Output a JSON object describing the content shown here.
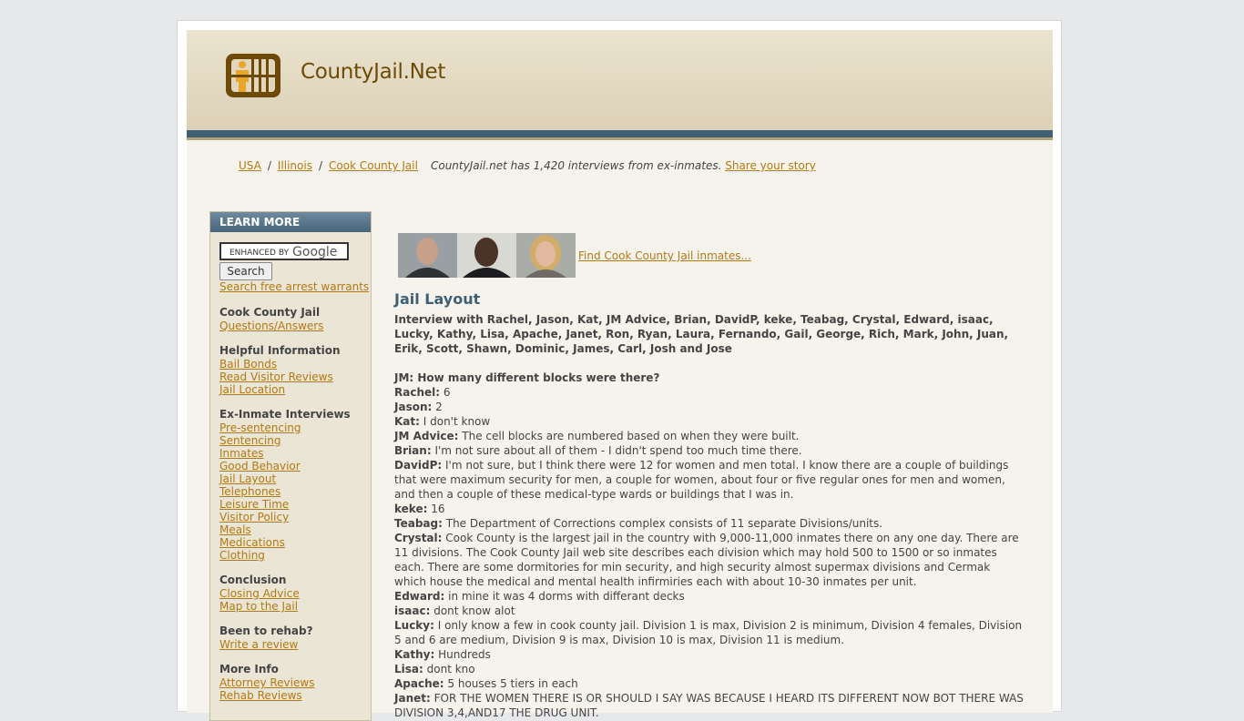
{
  "site": {
    "title": "CountyJail.Net",
    "brand_color": "#6e4a08",
    "band_color": "#3f5f75",
    "link_color": "#b17a14"
  },
  "breadcrumb": {
    "items": [
      "USA",
      "Illinois",
      "Cook County Jail"
    ],
    "note": "CountyJail.net has 1,420 interviews from ex-inmates.",
    "share_link": "Share your story"
  },
  "sidebar": {
    "heading": "LEARN MORE",
    "search_prefix": "ENHANCED BY",
    "search_brand": "Google",
    "search_button": "Search",
    "warrants_link": "Search free arrest warrants",
    "sections": [
      {
        "title": "Cook County Jail",
        "links": [
          "Questions/Answers"
        ]
      },
      {
        "title": "Helpful Information",
        "links": [
          "Bail Bonds",
          "Read Visitor Reviews",
          "Jail Location"
        ]
      },
      {
        "title": "Ex-Inmate Interviews",
        "links": [
          "Pre-sentencing",
          "Sentencing",
          "Inmates",
          "Good Behavior",
          "Jail Layout",
          "Telephones",
          "Leisure Time",
          "Visitor Policy",
          "Meals",
          "Medications",
          "Clothing"
        ]
      },
      {
        "title": "Conclusion",
        "links": [
          "Closing Advice",
          "Map to the Jail"
        ]
      },
      {
        "title": "Been to rehab?",
        "links": [
          "Write a review"
        ]
      },
      {
        "title": "More Info",
        "links": [
          "Attorney Reviews",
          "Rehab Reviews"
        ]
      }
    ]
  },
  "main": {
    "find_link": "Find Cook County Jail inmates...",
    "heading": "Jail Layout",
    "interview_with": "Interview with Rachel, Jason, Kat, JM Advice, Brian, DavidP, keke, Teabag, Crystal, Edward, isaac, Lucky, Kathy, Lisa, Apache, Janet, Ron, Ryan, Laura, Fernando, Gail, George, Rich, Mark, John, Juan, Erik, Scott, Shawn, Dominic, James, Carl, Josh and Jose",
    "question": "JM: How many different blocks were there?",
    "answers": [
      {
        "name": "Rachel:",
        "text": "6"
      },
      {
        "name": "Jason:",
        "text": "2"
      },
      {
        "name": "Kat:",
        "text": "I don't know"
      },
      {
        "name": "JM Advice:",
        "text": "The cell blocks are numbered based on when they were built."
      },
      {
        "name": "Brian:",
        "text": "I'm not sure about all of them - I didn't spend too much time there."
      },
      {
        "name": "DavidP:",
        "text": "I'm not sure, but I think there were 12 for women and men total. I know there are a couple of buildings that were maximum security for men, a couple for women, about four or five regular ones for men and women, and then a couple of these medical-type wards or buildings that I was in."
      },
      {
        "name": "keke:",
        "text": "16"
      },
      {
        "name": "Teabag:",
        "text": "The Department of Corrections complex consists of 11 separate Divisions/units."
      },
      {
        "name": "Crystal:",
        "text": "Cook County is the largest jail in the country with 9,000-11,000 inmates there on any one day. There are 11 divisions. The Cook County Jail web site describes each division which may hold 500 to 1500 or so inmates each. There are some dormitories for min security, and high security almost supermax divisions and Cermak which house the medical and mental health infirmiries each with about 10-30 inmates per unit."
      },
      {
        "name": "Edward:",
        "text": "in mine it was 4 dorms with differant decks"
      },
      {
        "name": "isaac:",
        "text": "dont know alot"
      },
      {
        "name": "Lucky:",
        "text": "I only know a few in cook county jail. Division 1 is max, Division 2 is minimum, Division 4 females, Division 5 and 6 are medium, Division 9 is max, Division 10 is max, Division 11 is medium."
      },
      {
        "name": "Kathy:",
        "text": "Hundreds"
      },
      {
        "name": "Lisa:",
        "text": "dont kno"
      },
      {
        "name": "Apache:",
        "text": "5 houses 5 tiers in each"
      },
      {
        "name": "Janet:",
        "text": "FOR THE WOMEN THERE IS OR SHOULD I SAY WAS BECAUSE I HEARD ITS DIFFERENT NOW BOT THERE WAS DIVISION 3,4,AND17 THE DRUG UNIT."
      }
    ]
  }
}
